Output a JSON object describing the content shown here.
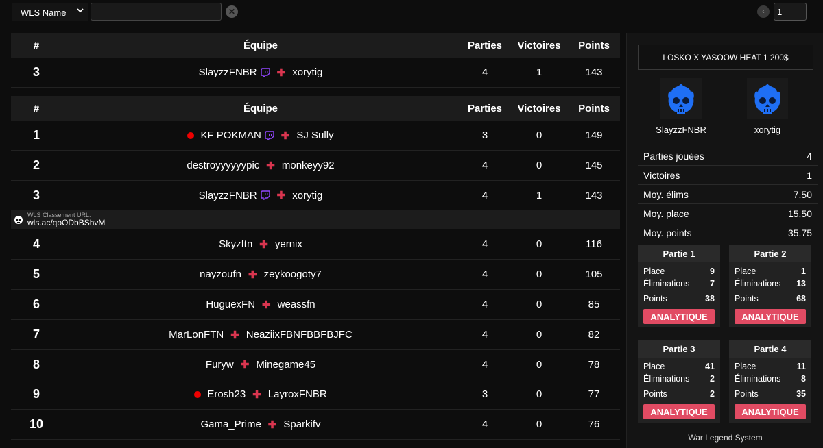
{
  "filters": {
    "field_label": "WLS Name",
    "search_value": "",
    "page_value": "1"
  },
  "table_headers": {
    "num": "#",
    "team": "Équipe",
    "parties": "Parties",
    "victoires": "Victoires",
    "points": "Points"
  },
  "selected_row": {
    "rank": "3",
    "p1": "SlayzzFNBR",
    "p2": "xorytig",
    "parties": "4",
    "victoires": "1",
    "points": "143"
  },
  "rows_a": [
    {
      "rank": "1",
      "p1": "KF POKMAN",
      "p2": "SJ Sully",
      "parties": "3",
      "victoires": "0",
      "points": "149"
    },
    {
      "rank": "2",
      "p1": "destroyyyyyypic",
      "p2": "monkeyy92",
      "parties": "4",
      "victoires": "0",
      "points": "145"
    },
    {
      "rank": "3",
      "p1": "SlayzzFNBR",
      "p2": "xorytig",
      "parties": "4",
      "victoires": "1",
      "points": "143"
    }
  ],
  "url_banner": {
    "label": "WLS Classement URL:",
    "link": "wls.ac/qoODbBShvM"
  },
  "rows_b": [
    {
      "rank": "4",
      "p1": "Skyzftn",
      "p2": "yernix",
      "parties": "4",
      "victoires": "0",
      "points": "116"
    },
    {
      "rank": "5",
      "p1": "nayzoufn",
      "p2": "zeykoogoty7",
      "parties": "4",
      "victoires": "0",
      "points": "105"
    },
    {
      "rank": "6",
      "p1": "HuguexFN",
      "p2": "weassfn",
      "parties": "4",
      "victoires": "0",
      "points": "85"
    },
    {
      "rank": "7",
      "p1": "MarLonFTN",
      "p2": "NeaziixFBNFBBFBJFC",
      "parties": "4",
      "victoires": "0",
      "points": "82"
    },
    {
      "rank": "8",
      "p1": "Furyw",
      "p2": "Minegame45",
      "parties": "4",
      "victoires": "0",
      "points": "78"
    },
    {
      "rank": "9",
      "p1": "Erosh23",
      "p2": "LayroxFNBR",
      "parties": "3",
      "victoires": "0",
      "points": "77"
    },
    {
      "rank": "10",
      "p1": "Gama_Prime",
      "p2": "Sparkifv",
      "parties": "4",
      "victoires": "0",
      "points": "76"
    }
  ],
  "panel": {
    "event_name": "LOSKO X YASOOW HEAT 1 200$",
    "player1": "SlayzzFNBR",
    "player2": "xorytig",
    "stats": [
      {
        "label": "Parties jouées",
        "value": "4"
      },
      {
        "label": "Victoires",
        "value": "1"
      },
      {
        "label": "Moy. élims",
        "value": "7.50"
      },
      {
        "label": "Moy. place",
        "value": "15.50"
      },
      {
        "label": "Moy. points",
        "value": "35.75"
      }
    ],
    "games": [
      {
        "title": "Partie 1",
        "place": "9",
        "elims": "7",
        "points": "38"
      },
      {
        "title": "Partie 2",
        "place": "1",
        "elims": "13",
        "points": "68"
      },
      {
        "title": "Partie 3",
        "place": "41",
        "elims": "2",
        "points": "2"
      },
      {
        "title": "Partie 4",
        "place": "11",
        "elims": "8",
        "points": "35"
      }
    ],
    "labels": {
      "place": "Place",
      "elims": "Éliminations",
      "points": "Points",
      "button": "ANALYTIQUE"
    },
    "footer": "War Legend System"
  },
  "colors": {
    "accent": "#e14b63",
    "plus": "#d9354f",
    "twitch": "#9146ff",
    "live": "#ee0000",
    "logo_blue": "#1f6ff5"
  }
}
